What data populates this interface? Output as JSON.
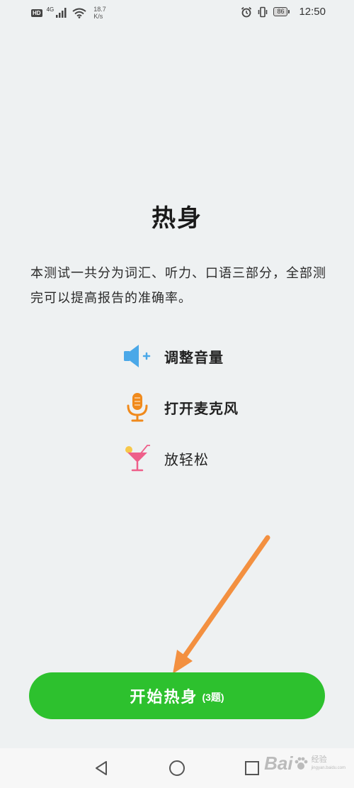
{
  "status_bar": {
    "hd_badge": "HD",
    "network_gen": "4G",
    "speed_value": "18.7",
    "speed_unit": "K/s",
    "battery": "86",
    "time": "12:50",
    "icons": [
      "signal-icon",
      "wifi-icon",
      "alarm-icon",
      "vibrate-icon",
      "battery-icon"
    ]
  },
  "page": {
    "title": "热身",
    "description": "本测试一共分为词汇、听力、口语三部分，全部测完可以提高报告的准确率。"
  },
  "tips": [
    {
      "icon": "speaker-volume-icon",
      "label": "调整音量"
    },
    {
      "icon": "microphone-icon",
      "label": "打开麦克风"
    },
    {
      "icon": "cocktail-icon",
      "label": "放轻松"
    }
  ],
  "start_button": {
    "label": "开始热身",
    "count": "(3题)"
  },
  "nav_bar": {
    "buttons": [
      "back-icon",
      "home-icon",
      "recents-icon"
    ]
  },
  "watermark": {
    "logo": "Bai",
    "sub_top": "经验",
    "sub_bottom": "jingyan.baidu.com"
  },
  "colors": {
    "background": "#eef1f2",
    "button": "#2dc12e",
    "arrow": "#f39040",
    "speaker": "#4aa8e8",
    "microphone": "#f08a1c",
    "cocktail": "#ee5f8a"
  }
}
